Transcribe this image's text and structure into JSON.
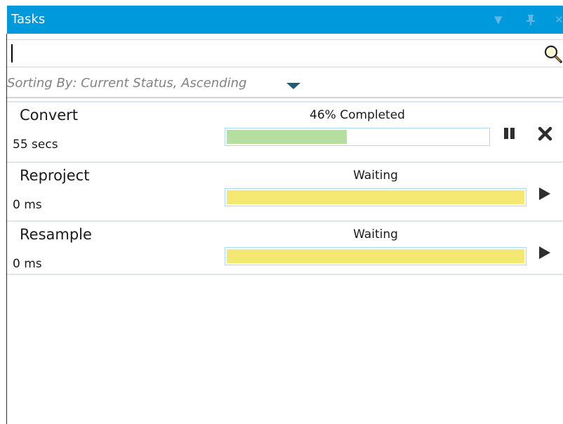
{
  "panel": {
    "title": "Tasks",
    "title_icons": [
      "dropdown-arrow-icon",
      "pin-icon",
      "close-icon"
    ]
  },
  "search": {
    "value": "",
    "placeholder": "",
    "icon": "search-icon"
  },
  "sort": {
    "label": "Sorting By: Current Status, Ascending",
    "icon": "chevron-down-icon"
  },
  "tasks": [
    {
      "name": "Convert",
      "time": "55 secs",
      "status": "46% Completed",
      "progress": 0.46,
      "bar_color": "#b5dfa1",
      "controls": [
        "pause-icon",
        "close-icon"
      ]
    },
    {
      "name": "Reproject",
      "time": "0 ms",
      "status": "Waiting",
      "progress": 1.0,
      "bar_color": "#f4e772",
      "controls": [
        "play-icon"
      ]
    },
    {
      "name": "Resample",
      "time": "0 ms",
      "status": "Waiting",
      "progress": 1.0,
      "bar_color": "#f4e772",
      "controls": [
        "play-icon"
      ]
    }
  ],
  "colors": {
    "titlebar": "#0099dc",
    "accent_border": "#a9dcf0"
  }
}
